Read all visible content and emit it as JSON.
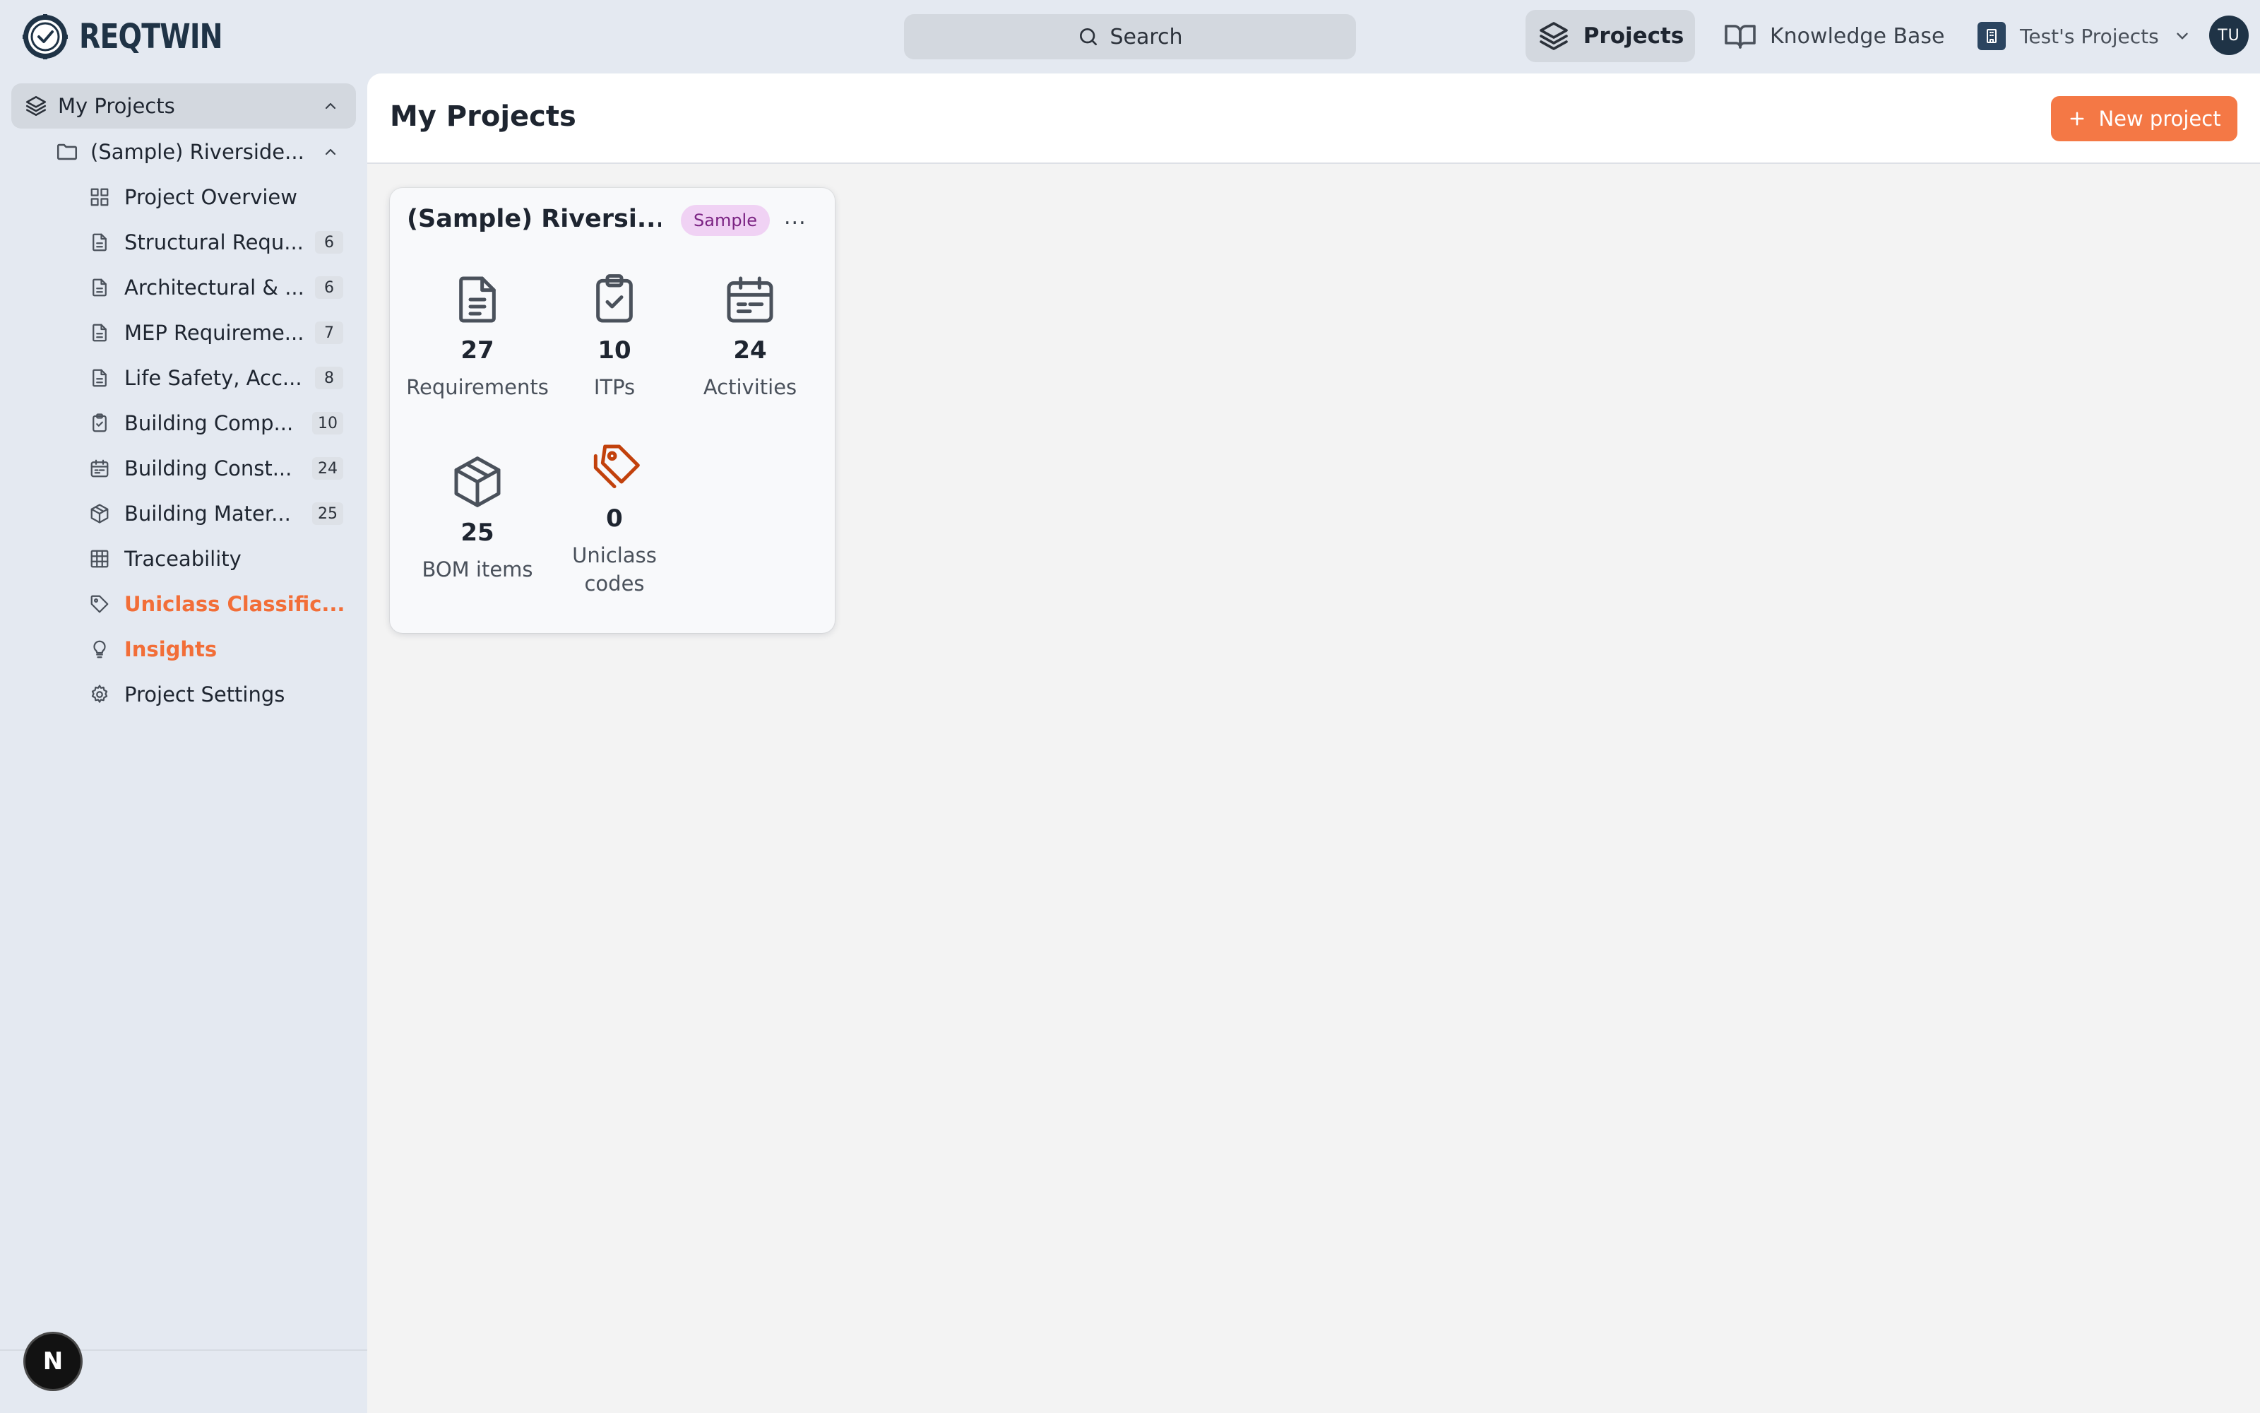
{
  "app": {
    "logo_text": "REQTWIN"
  },
  "topbar": {
    "search_label": "Search",
    "nav_projects": "Projects",
    "nav_knowledge_base": "Knowledge Base",
    "org_name": "Test's Projects",
    "avatar_initials": "TU"
  },
  "sidebar": {
    "root_label": "My Projects",
    "project_label": "(Sample) Riverside...",
    "items": [
      {
        "label": "Project Overview",
        "icon": "layout-grid-icon"
      },
      {
        "label": "Structural Requ...",
        "count": "6",
        "icon": "file-text-icon"
      },
      {
        "label": "Architectural & ...",
        "count": "6",
        "icon": "file-text-icon"
      },
      {
        "label": "MEP Requireme...",
        "count": "7",
        "icon": "file-text-icon"
      },
      {
        "label": "Life Safety, Acc...",
        "count": "8",
        "icon": "file-text-icon"
      },
      {
        "label": "Building Comp...",
        "count": "10",
        "icon": "clipboard-check-icon"
      },
      {
        "label": "Building Const...",
        "count": "24",
        "icon": "calendar-icon"
      },
      {
        "label": "Building Mater...",
        "count": "25",
        "icon": "package-icon"
      },
      {
        "label": "Traceability",
        "icon": "table-icon"
      },
      {
        "label": "Uniclass Classific...",
        "icon": "tag-icon"
      },
      {
        "label": "Insights",
        "icon": "lightbulb-icon"
      },
      {
        "label": "Project Settings",
        "icon": "settings-icon"
      }
    ],
    "fab_label": "N"
  },
  "main": {
    "title": "My Projects",
    "new_button": "New project",
    "card": {
      "title": "(Sample) Riversi...",
      "badge": "Sample",
      "menu": "...",
      "stats": [
        {
          "value": "27",
          "label": "Requirements",
          "icon": "file-text-icon"
        },
        {
          "value": "10",
          "label": "ITPs",
          "icon": "clipboard-check-icon"
        },
        {
          "value": "24",
          "label": "Activities",
          "icon": "calendar-icon"
        },
        {
          "value": "25",
          "label": "BOM items",
          "icon": "package-icon"
        },
        {
          "value": "0",
          "label": "Uniclass codes",
          "icon": "tags-icon"
        }
      ]
    }
  },
  "colors": {
    "accent": "#f47845",
    "badge_bg": "#f0d2f4",
    "badge_text": "#7b2383",
    "brand_dark": "#1f3346",
    "chrome_bg": "#e4e9f1"
  }
}
